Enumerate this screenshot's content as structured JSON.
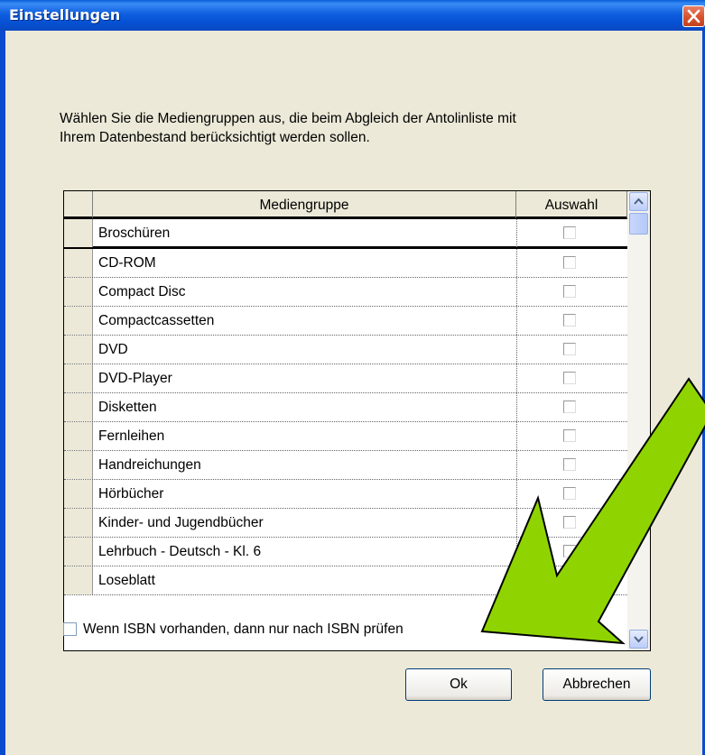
{
  "window": {
    "title": "Einstellungen"
  },
  "instruction": {
    "line1": "Wählen Sie die Mediengruppen aus, die beim Abgleich der Antolinliste mit",
    "line2": "Ihrem Datenbestand berücksichtigt werden sollen."
  },
  "grid": {
    "columns": [
      "Mediengruppe",
      "Auswahl"
    ],
    "rows": [
      {
        "name": "Broschüren",
        "checked": false
      },
      {
        "name": "CD-ROM",
        "checked": false
      },
      {
        "name": "Compact Disc",
        "checked": false
      },
      {
        "name": "Compactcassetten",
        "checked": false
      },
      {
        "name": "DVD",
        "checked": false
      },
      {
        "name": "DVD-Player",
        "checked": false
      },
      {
        "name": "Disketten",
        "checked": false
      },
      {
        "name": "Fernleihen",
        "checked": false
      },
      {
        "name": "Handreichungen",
        "checked": false
      },
      {
        "name": "Hörbücher",
        "checked": false
      },
      {
        "name": "Kinder- und Jugendbücher",
        "checked": false
      },
      {
        "name": "Lehrbuch - Deutsch - Kl. 6",
        "checked": false
      },
      {
        "name": "Loseblatt",
        "checked": false
      }
    ]
  },
  "isbn_option": {
    "label": "Wenn ISBN vorhanden, dann nur nach ISBN prüfen",
    "checked": false
  },
  "buttons": {
    "ok": "Ok",
    "cancel": "Abbrechen"
  },
  "colors": {
    "titlebar": "#0a5fd8",
    "dialog_bg": "#ece9d8",
    "arrow_fill": "#8fd400",
    "close_button": "#d9552f"
  }
}
